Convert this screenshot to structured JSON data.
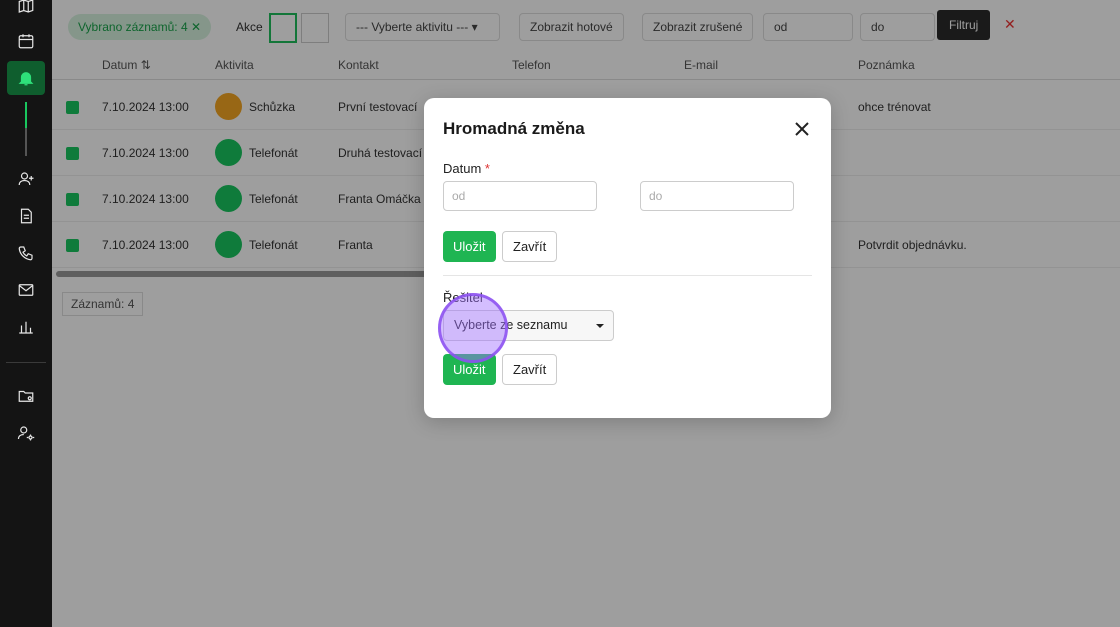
{
  "toolbar": {
    "chip_label": "Vybrano záznamů: 4 ✕",
    "akce_label": "Akce",
    "activity_select": "--- Vyberte aktivitu --- ▾",
    "show_done_label": "Zobrazit hotové",
    "show_cancelled_label": "Zobrazit zrušené",
    "date_from": "od",
    "date_to": "do",
    "filter_label": "Filtruj",
    "clear_label": "✕"
  },
  "table": {
    "headers": [
      "Datum ⇅",
      "Aktivita",
      "Kontakt",
      "Telefon",
      "E-mail",
      "Poznámka"
    ],
    "rows": [
      {
        "date": "7.10.2024 13:00",
        "activity": "Schůzka",
        "contact": "První testovací",
        "note": "ohce trénovat"
      },
      {
        "date": "7.10.2024 13:00",
        "activity": "Telefonát",
        "contact": "Druhá testovací",
        "note": ""
      },
      {
        "date": "7.10.2024 13:00",
        "activity": "Telefonát",
        "contact": "Franta Omáčka",
        "note": ""
      },
      {
        "date": "7.10.2024 13:00",
        "activity": "Telefonát",
        "contact": "Franta",
        "note": "Potvrdit objednávku."
      }
    ],
    "count_label": "Záznamů: 4"
  },
  "modal": {
    "title": "Hromadná změna",
    "date_section": {
      "label": "Datum",
      "required_mark": "*",
      "from_placeholder": "od",
      "to_placeholder": "do",
      "save_label": "Uložit",
      "close_label": "Zavřít"
    },
    "solver_section": {
      "label": "Řešitel",
      "select_value": "Vyberte ze seznamu",
      "save_label": "Uložit",
      "close_label": "Zavřít"
    }
  },
  "colors": {
    "accent": "#1fb552",
    "sidebar": "#141414",
    "cursor": "#a06eff"
  }
}
